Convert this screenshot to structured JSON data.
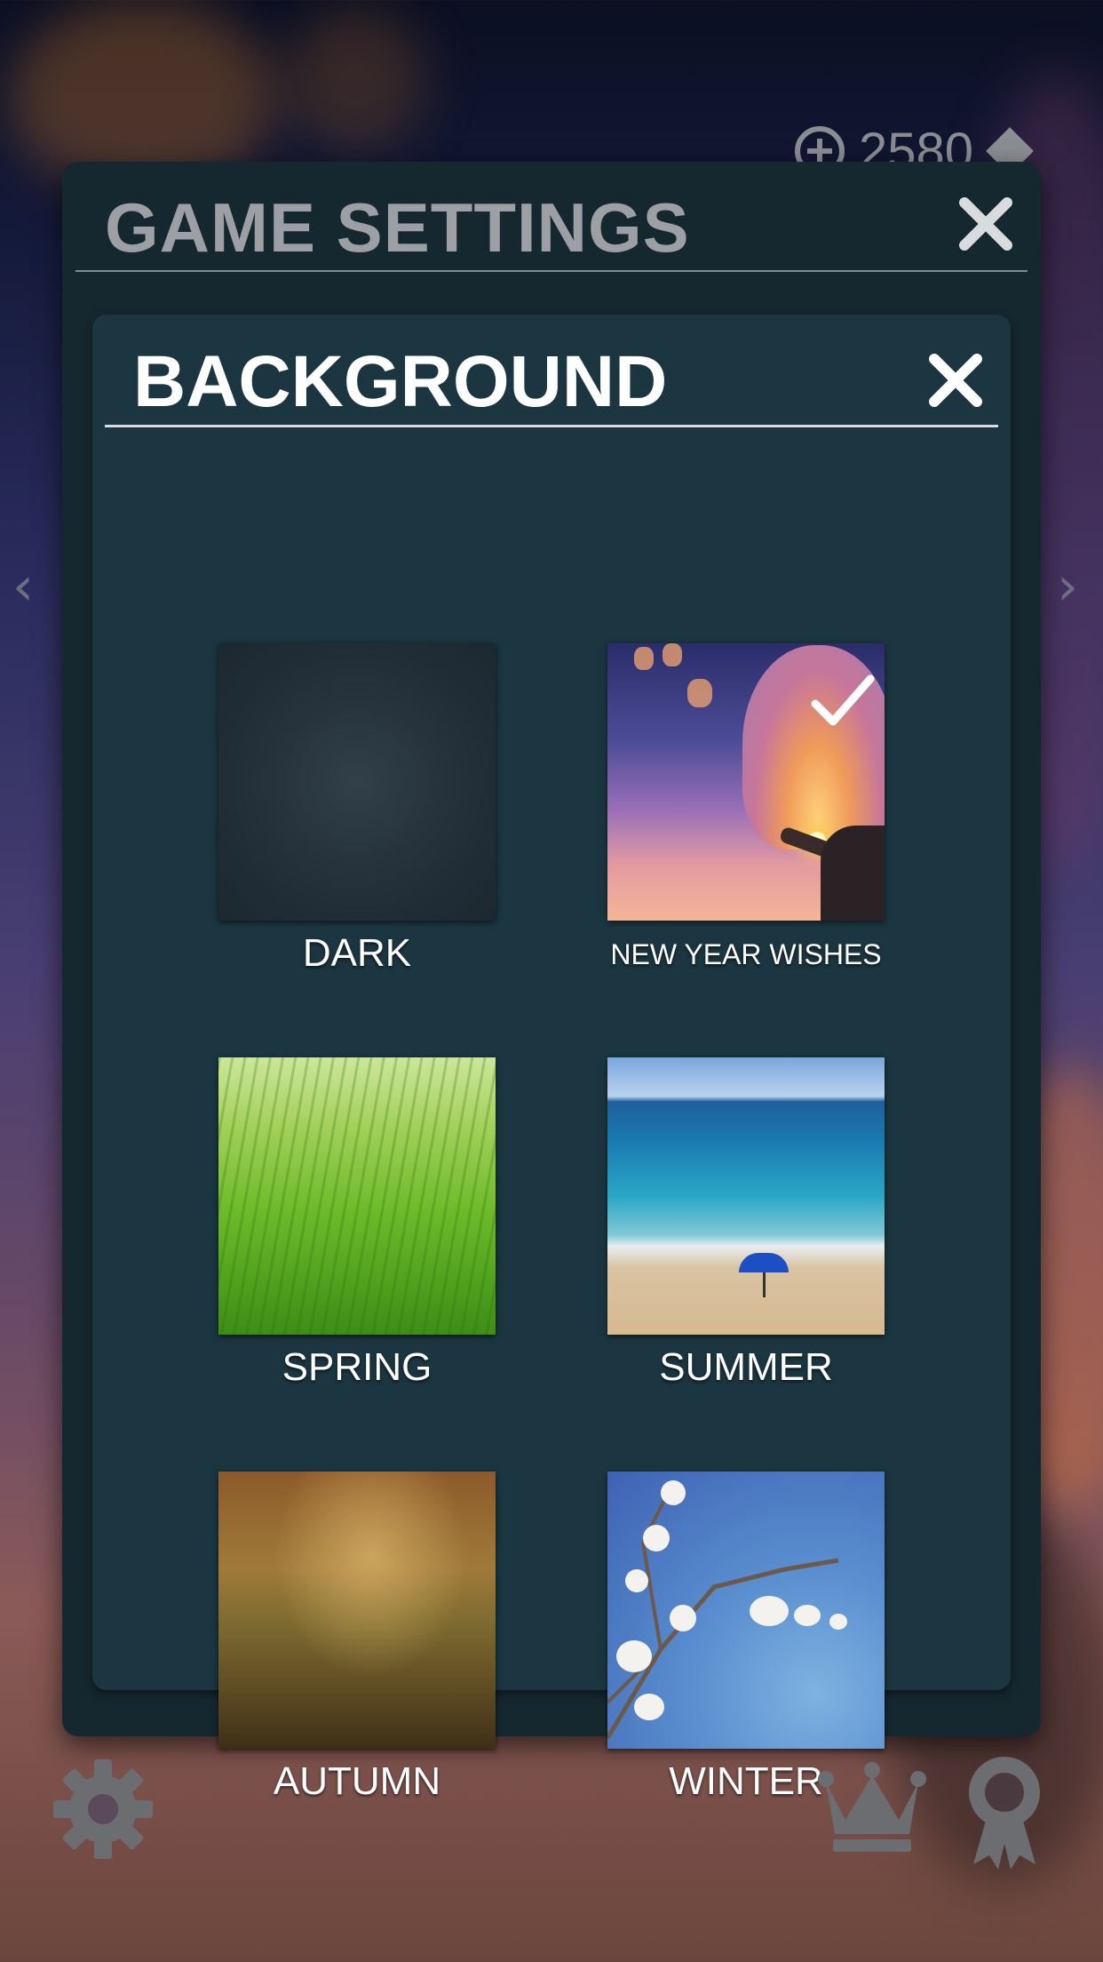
{
  "header": {
    "currency_amount": "2580"
  },
  "settings_panel": {
    "title": "GAME SETTINGS"
  },
  "background_panel": {
    "title": "BACKGROUND",
    "options": [
      {
        "label": "DARK",
        "selected": false
      },
      {
        "label": "NEW YEAR WISHES",
        "selected": true
      },
      {
        "label": "SPRING",
        "selected": false
      },
      {
        "label": "SUMMER",
        "selected": false
      },
      {
        "label": "AUTUMN",
        "selected": false
      },
      {
        "label": "WINTER",
        "selected": false
      }
    ]
  },
  "icons": {
    "settings": "gear-icon",
    "leaderboard": "crown-icon",
    "achievements": "award-icon",
    "close": "close-icon",
    "selected": "checkmark-icon",
    "add_currency": "plus-circle-icon",
    "currency": "diamond-icon",
    "prev": "chevron-left-icon",
    "next": "chevron-right-icon"
  },
  "colors": {
    "panel": "#15282f",
    "inner_panel": "#1b3640",
    "title_gray": "#9c9fa3",
    "white": "#ffffff"
  }
}
